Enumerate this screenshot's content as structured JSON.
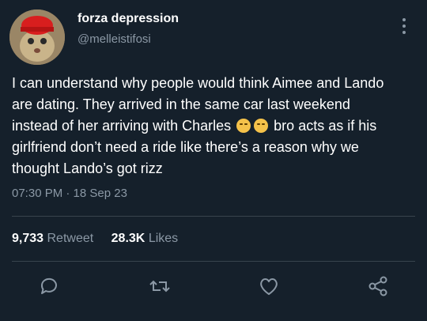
{
  "user": {
    "display_name": "forza depression",
    "handle": "@melleistifosi"
  },
  "tweet": {
    "line1": "I can understand why people would think Aimee and Lando",
    "line2": "are dating. They arrived in the same car last weekend",
    "line3_pre": "instead of her arriving with Charles",
    "line3_post": "bro acts as if his",
    "line4": "girlfriend don’t need a ride like there’s a reason why we",
    "line5": "thought Lando’s got rizz",
    "timestamp": "07:30 PM · 18 Sep 23"
  },
  "stats": {
    "retweets_count": "9,733",
    "retweets_label": "Retweet",
    "likes_count": "28.3K",
    "likes_label": "Likes"
  },
  "icons": {
    "reply": "reply-icon",
    "retweet": "retweet-icon",
    "like": "heart-icon",
    "share": "share-icon",
    "more": "more-vertical-icon"
  },
  "colors": {
    "background": "#15202b",
    "secondary_text": "#8b98a5",
    "divider": "#38444d"
  }
}
